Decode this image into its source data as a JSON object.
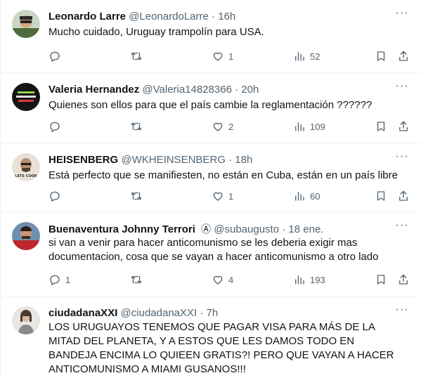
{
  "tweets": [
    {
      "name": "Leonardo Larre",
      "handle": "@LeonardoLarre",
      "time": "16h",
      "text": "Mucho cuidado, Uruguay trampolín para USA.",
      "replies": "",
      "retweets": "",
      "likes": "1",
      "views": "52"
    },
    {
      "name": "Valeria Hernandez",
      "handle": "@Valeria14828366",
      "time": "20h",
      "text": "Quienes son ellos para que el país cambie la reglamentación ??????",
      "replies": "",
      "retweets": "",
      "likes": "2",
      "views": "109"
    },
    {
      "name": "HEISENBERG",
      "handle": "@WKHEINSENBERG",
      "time": "18h",
      "text": "Está perfecto que se manifiesten, no están en Cuba, están en un país libre",
      "replies": "",
      "retweets": "",
      "likes": "1",
      "views": "60",
      "avatar_text": "LETS COOK"
    },
    {
      "name": "Buenaventura Johnny Terrori",
      "badge": "Ⓐ",
      "handle": "@subaugusto",
      "time": "18 ene.",
      "text": "si van a venir para hacer anticomunismo se les deberia exigir  mas documentacion, cosa que se vayan a hacer anticomunismo a otro lado",
      "replies": "1",
      "retweets": "",
      "likes": "4",
      "views": "193"
    },
    {
      "name": "ciudadanaXXI",
      "handle": "@ciudadanaXXI",
      "time": "7h",
      "text": "LOS URUGUAYOS TENEMOS QUE PAGAR  VISA PARA MÁS DE LA MITAD DEL PLANETA, Y A ESTOS QUE LES DAMOS TODO EN BANDEJA ENCIMA LO QUIEEN GRATIS?! PERO QUE VAYAN A HACER ANTICOMUNISMO  A MIAMI GUSANOS!!!"
    }
  ],
  "separator": "·",
  "more_glyph": "···",
  "colors": {
    "text": "#0f1419",
    "secondary": "#536471",
    "border": "#eff3f4"
  }
}
